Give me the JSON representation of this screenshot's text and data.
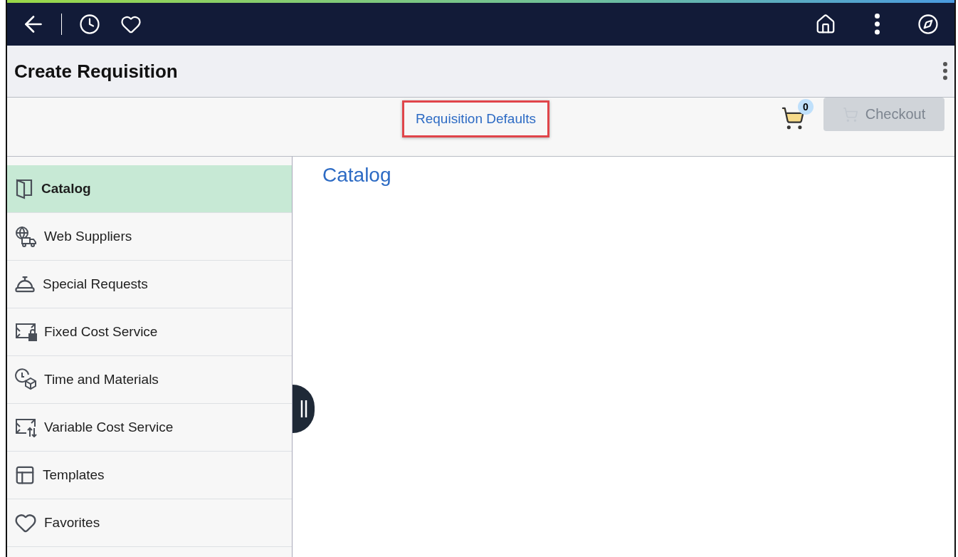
{
  "page_header": {
    "title": "Create Requisition"
  },
  "toolbar": {
    "link": {
      "label": "Requisition Defaults",
      "highlighted": true
    },
    "cart": {
      "count": "0"
    },
    "checkout": {
      "label": "Checkout",
      "disabled": true
    }
  },
  "sidebar": {
    "items": [
      {
        "label": "Catalog",
        "selected": true
      },
      {
        "label": "Web Suppliers",
        "selected": false
      },
      {
        "label": "Special Requests",
        "selected": false
      },
      {
        "label": "Fixed Cost Service",
        "selected": false
      },
      {
        "label": "Time and Materials",
        "selected": false
      },
      {
        "label": "Variable Cost Service",
        "selected": false
      },
      {
        "label": "Templates",
        "selected": false
      },
      {
        "label": "Favorites",
        "selected": false
      }
    ]
  },
  "content": {
    "heading": "Catalog"
  }
}
